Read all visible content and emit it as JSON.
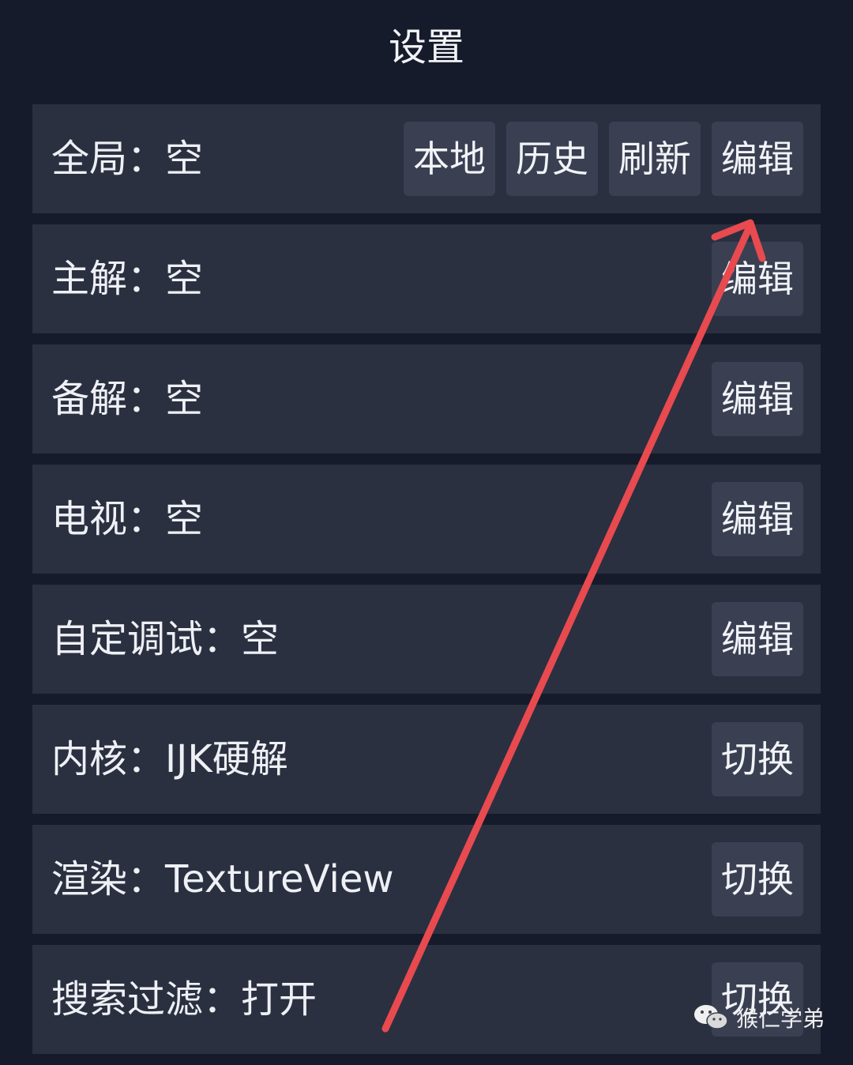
{
  "header": {
    "title": "设置"
  },
  "rows": [
    {
      "label": "全局：空",
      "buttons": [
        "本地",
        "历史",
        "刷新",
        "编辑"
      ]
    },
    {
      "label": "主解：空",
      "buttons": [
        "编辑"
      ]
    },
    {
      "label": "备解：空",
      "buttons": [
        "编辑"
      ]
    },
    {
      "label": "电视：空",
      "buttons": [
        "编辑"
      ]
    },
    {
      "label": "自定调试：空",
      "buttons": [
        "编辑"
      ]
    },
    {
      "label": "内核：IJK硬解",
      "buttons": [
        "切换"
      ]
    },
    {
      "label": "渲染：TextureView",
      "buttons": [
        "切换"
      ]
    },
    {
      "label": "搜索过滤：打开",
      "buttons": [
        "切换"
      ]
    }
  ],
  "annotation": {
    "color": "#e84a4f",
    "icon": "arrow-icon"
  },
  "watermark": {
    "text": "猴仁学弟",
    "icon": "wechat-icon"
  },
  "colors": {
    "background": "#161b2b",
    "row": "#2a3040",
    "button": "#3a4052",
    "text": "#eef0f5"
  }
}
